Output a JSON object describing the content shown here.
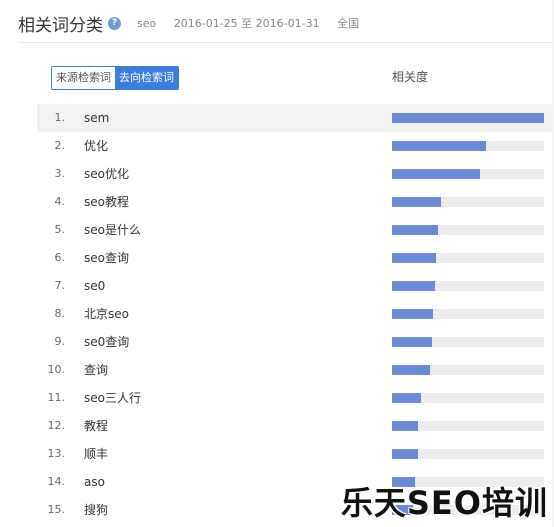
{
  "header": {
    "title": "相关词分类",
    "help_icon": "question-icon",
    "keyword": "seo",
    "date_range": "2016-01-25 至 2016-01-31",
    "region": "全国"
  },
  "tabs": [
    {
      "label": "来源检索词",
      "active": false
    },
    {
      "label": "去向检索词",
      "active": true
    }
  ],
  "columns": {
    "relevance": "相关度"
  },
  "colors": {
    "accent": "#3b7ddd",
    "bar": "#6a8ad8",
    "track": "#ededed"
  },
  "rows": [
    {
      "rank": "1.",
      "word": "sem",
      "relevance": 1.0
    },
    {
      "rank": "2.",
      "word": "优化",
      "relevance": 0.62
    },
    {
      "rank": "3.",
      "word": "seo优化",
      "relevance": 0.58
    },
    {
      "rank": "4.",
      "word": "seo教程",
      "relevance": 0.32
    },
    {
      "rank": "5.",
      "word": "seo是什么",
      "relevance": 0.3
    },
    {
      "rank": "6.",
      "word": "seo查询",
      "relevance": 0.29
    },
    {
      "rank": "7.",
      "word": "se0",
      "relevance": 0.28
    },
    {
      "rank": "8.",
      "word": "北京seo",
      "relevance": 0.27
    },
    {
      "rank": "9.",
      "word": "se0查询",
      "relevance": 0.26
    },
    {
      "rank": "10.",
      "word": "查询",
      "relevance": 0.25
    },
    {
      "rank": "11.",
      "word": "seo三人行",
      "relevance": 0.19
    },
    {
      "rank": "12.",
      "word": "教程",
      "relevance": 0.17
    },
    {
      "rank": "13.",
      "word": "顺丰",
      "relevance": 0.17
    },
    {
      "rank": "14.",
      "word": "aso",
      "relevance": 0.15
    },
    {
      "rank": "15.",
      "word": "搜狗",
      "relevance": 0.14
    }
  ],
  "watermark": "乐天SEO培训"
}
